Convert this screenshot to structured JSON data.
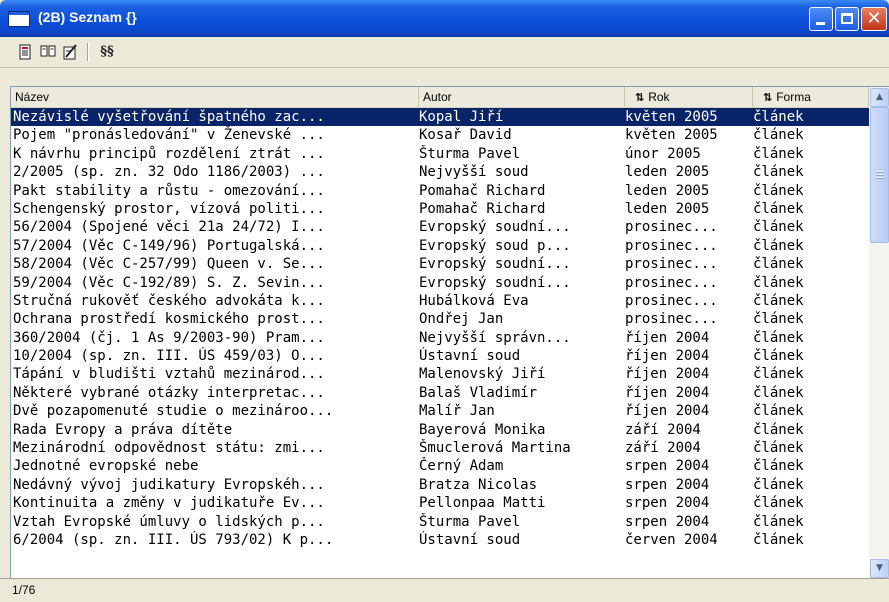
{
  "window": {
    "title": "(2B)  Seznam {}"
  },
  "toolbar": {
    "section_label": "§§"
  },
  "columns": [
    {
      "label": "Název",
      "sortable": false
    },
    {
      "label": "Autor",
      "sortable": false
    },
    {
      "label": "Rok",
      "sortable": true
    },
    {
      "label": "Forma",
      "sortable": true
    }
  ],
  "rows": [
    [
      "Nezávislé vyšetřování špatného zac...",
      "Kopal Jiří",
      "květen 2005",
      "článek"
    ],
    [
      "Pojem \"pronásledování\" v Ženevské ...",
      "Kosař David",
      "květen 2005",
      "článek"
    ],
    [
      "K návrhu principů rozdělení ztrát ...",
      "Šturma Pavel",
      "únor 2005",
      "článek"
    ],
    [
      "2/2005 (sp. zn. 32 Odo 1186/2003) ...",
      "Nejvyšší soud",
      "leden 2005",
      "článek"
    ],
    [
      "Pakt stability a růstu - omezování...",
      "Pomahač Richard",
      "leden 2005",
      "článek"
    ],
    [
      "Schengenský prostor, vízová politi...",
      "Pomahač Richard",
      "leden 2005",
      "článek"
    ],
    [
      "56/2004 (Spojené věci 21a 24/72) I...",
      "Evropský soudní...",
      "prosinec...",
      "článek"
    ],
    [
      "57/2004 (Věc C-149/96) Portugalská...",
      "Evropský soud p...",
      "prosinec...",
      "článek"
    ],
    [
      "58/2004 (Věc C-257/99) Queen v. Se...",
      "Evropský soudní...",
      "prosinec...",
      "článek"
    ],
    [
      "59/2004 (Věc C-192/89) S. Z. Sevin...",
      "Evropský soudní...",
      "prosinec...",
      "článek"
    ],
    [
      "Stručná rukověť českého advokáta k...",
      "Hubálková Eva",
      "prosinec...",
      "článek"
    ],
    [
      "Ochrana prostředí kosmického prost...",
      "Ondřej Jan",
      "prosinec...",
      "článek"
    ],
    [
      "360/2004 (čj. 1 As 9/2003-90) Pram...",
      "Nejvyšší správn...",
      "říjen 2004",
      "článek"
    ],
    [
      "10/2004 (sp. zn. III. ÚS 459/03) O...",
      "Ústavní soud",
      "říjen 2004",
      "článek"
    ],
    [
      "Tápání v bludišti vztahů mezinárod...",
      "Malenovský Jiří",
      "říjen 2004",
      "článek"
    ],
    [
      "Některé vybrané otázky interpretac...",
      "Balaš Vladimír",
      "říjen 2004",
      "článek"
    ],
    [
      "Dvě pozapomenuté studie o mezinároo...",
      "Malíř Jan",
      "říjen 2004",
      "článek"
    ],
    [
      "Rada Evropy a práva dítěte",
      "Bayerová Monika",
      "září 2004",
      "článek"
    ],
    [
      "Mezinárodní odpovědnost státu: zmi...",
      "Šmuclerová Martina",
      "září 2004",
      "článek"
    ],
    [
      "Jednotné evropské nebe",
      "Černý Adam",
      "srpen 2004",
      "článek"
    ],
    [
      "Nedávný vývoj judikatury Evropskéh...",
      "Bratza Nicolas",
      "srpen 2004",
      "článek"
    ],
    [
      "Kontinuita a změny v judikatuře Ev...",
      "Pellonpaa Matti",
      "srpen 2004",
      "článek"
    ],
    [
      "Vztah Evropské úmluvy o lidských p...",
      "Šturma Pavel",
      "srpen 2004",
      "článek"
    ],
    [
      "6/2004 (sp. zn. III. ÚS 793/02) K p...",
      "Ústavní soud",
      "červen 2004",
      "článek"
    ]
  ],
  "status": {
    "text": "1/76"
  }
}
